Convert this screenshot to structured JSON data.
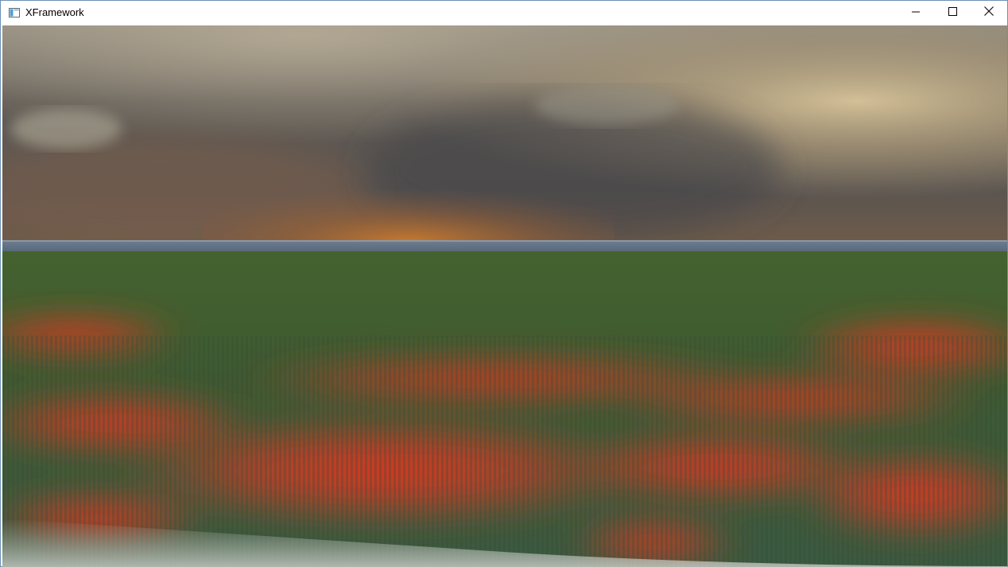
{
  "window": {
    "title": "XFramework",
    "app_icon": "application-window-icon",
    "controls": {
      "minimize_icon": "minimize-icon",
      "maximize_icon": "maximize-icon",
      "close_icon": "close-icon"
    }
  },
  "scene": {
    "description_icon": "3d-render-viewport",
    "colors": {
      "sky_dark": "#55514c",
      "sky_light": "#c9b68f",
      "horizon_orange": "#c77a2e",
      "water": "#5c6f86",
      "grass": "#3f5a30",
      "flowers": "#d63a22"
    }
  }
}
